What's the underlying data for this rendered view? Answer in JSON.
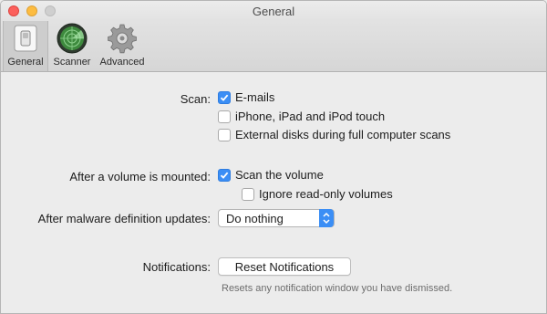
{
  "window": {
    "title": "General"
  },
  "toolbar": {
    "items": [
      {
        "label": "General",
        "icon": "general-switch-icon",
        "selected": true
      },
      {
        "label": "Scanner",
        "icon": "radar-icon",
        "selected": false
      },
      {
        "label": "Advanced",
        "icon": "gear-icon",
        "selected": false
      }
    ]
  },
  "scan": {
    "label": "Scan:",
    "options": [
      {
        "label": "E-mails",
        "checked": true
      },
      {
        "label": "iPhone, iPad and iPod touch",
        "checked": false
      },
      {
        "label": "External disks during full computer scans",
        "checked": false
      }
    ]
  },
  "volume": {
    "label": "After a volume is mounted:",
    "scan_option": {
      "label": "Scan the volume",
      "checked": true
    },
    "ignore_option": {
      "label": "Ignore read-only volumes",
      "checked": false
    }
  },
  "updates": {
    "label": "After malware definition updates:",
    "selected": "Do nothing"
  },
  "notifications": {
    "label": "Notifications:",
    "button_label": "Reset Notifications",
    "hint": "Resets any notification window you have dismissed."
  },
  "colors": {
    "accent": "#3b8ef5",
    "window_bg": "#ececec"
  }
}
